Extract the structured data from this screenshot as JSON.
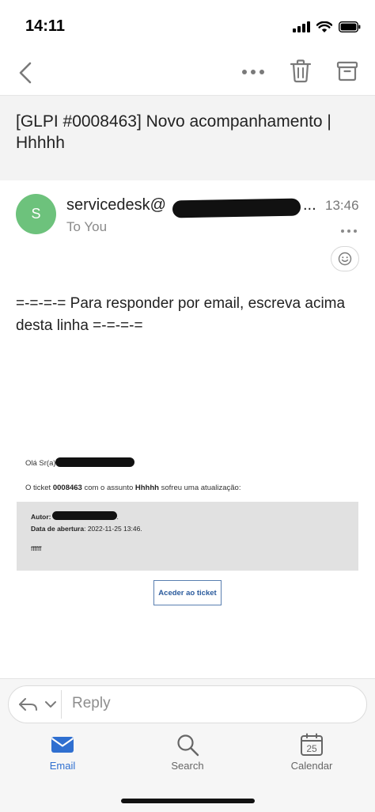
{
  "status_bar": {
    "time": "14:11"
  },
  "icons": {
    "back": "chevron-left-icon",
    "more": "ellipsis-icon",
    "delete": "trash-icon",
    "archive": "archive-icon",
    "emoji": "smiley-icon",
    "reply_all": "reply-icon",
    "dropdown": "chevron-down-icon",
    "mail": "mail-icon",
    "search": "search-icon",
    "calendar": "calendar-icon"
  },
  "colors": {
    "accent": "#2f6fd0",
    "avatar": "#6dc27c",
    "info_box": "#e1e1e1"
  },
  "email": {
    "subject": "[GLPI #0008463] Novo acompanhamento | Hhhhh",
    "sender": {
      "initial": "S",
      "name": "servicedesk@",
      "ellipsis": "...",
      "time": "13:46",
      "to": "To You"
    },
    "body": {
      "reply_marker": "=-=-=-= Para responder por email, escreva acima desta linha =-=-=-=",
      "greeting": "Olá Sr(a)",
      "update_prefix": "O ticket ",
      "ticket_number": "0008463",
      "update_middle": " com o assunto ",
      "ticket_subject": "Hhhhh",
      "update_suffix": " sofreu uma atualização:",
      "autor_label": "Autor:",
      "autor_suffix": ".",
      "data_label": "Data de abertura",
      "data_value": ": 2022-11-25 13:46.",
      "content": "ffffff",
      "button_label": "Aceder ao ticket"
    }
  },
  "reply_bar": {
    "placeholder": "Reply"
  },
  "tabs": [
    {
      "label": "Email",
      "active": true
    },
    {
      "label": "Search",
      "active": false
    },
    {
      "label": "Calendar",
      "active": false,
      "calendar_day": "25"
    }
  ]
}
